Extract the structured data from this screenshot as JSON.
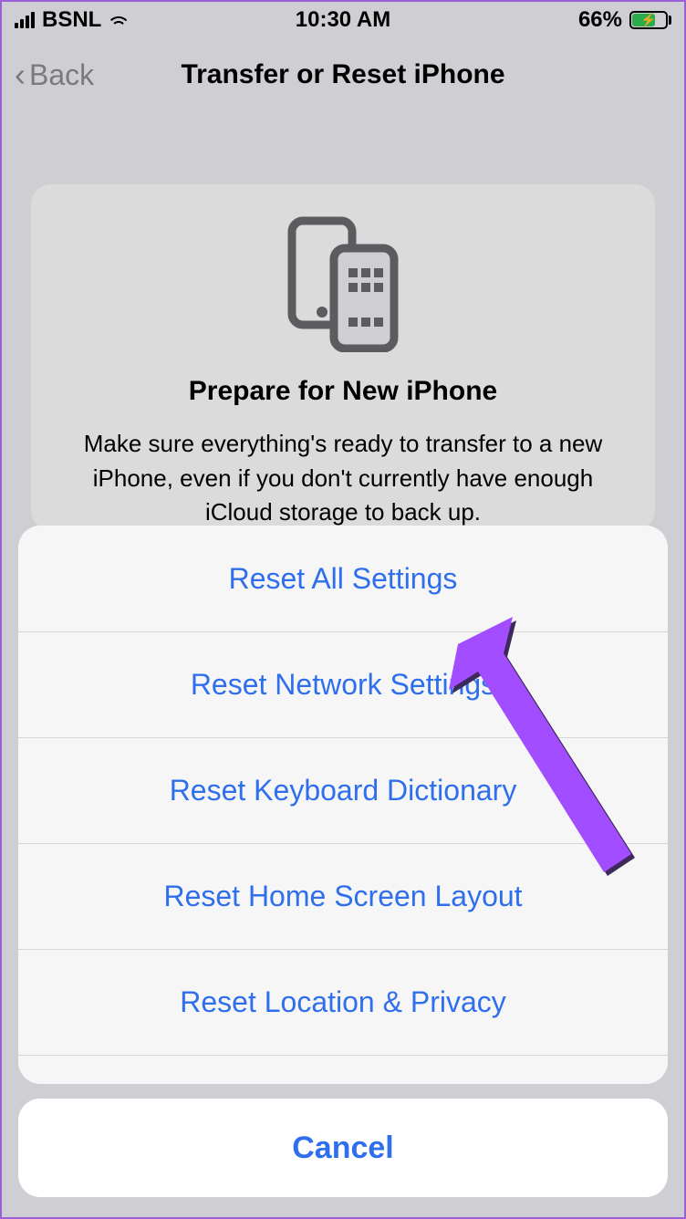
{
  "statusbar": {
    "carrier": "BSNL",
    "time": "10:30 AM",
    "battery": "66%"
  },
  "nav": {
    "back": "Back",
    "title": "Transfer or Reset iPhone"
  },
  "card": {
    "heading": "Prepare for New iPhone",
    "body": "Make sure everything's ready to transfer to a new iPhone, even if you don't currently have enough iCloud storage to back up."
  },
  "sheet": {
    "options": [
      "Reset All Settings",
      "Reset Network Settings",
      "Reset Keyboard Dictionary",
      "Reset Home Screen Layout",
      "Reset Location & Privacy"
    ],
    "peek": "",
    "cancel": "Cancel"
  }
}
